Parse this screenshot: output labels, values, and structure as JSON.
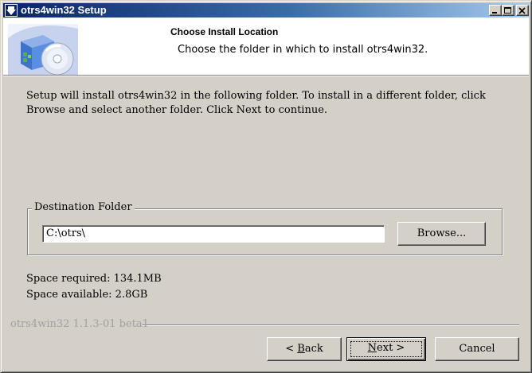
{
  "window": {
    "title": "otrs4win32 Setup"
  },
  "header": {
    "title": "Choose Install Location",
    "subtitle": "Choose the folder in which to install otrs4win32."
  },
  "body": {
    "intro": "Setup will install otrs4win32 in the following folder. To install in a different folder, click Browse and select another folder. Click Next to continue."
  },
  "destination": {
    "group_label": "Destination Folder",
    "path_value": "C:\\otrs\\",
    "browse_label": "Browse..."
  },
  "space": {
    "required": "Space required: 134.1MB",
    "available": "Space available: 2.8GB"
  },
  "footer": {
    "brand": "otrs4win32 1.1.3-01 beta1",
    "back_prefix": "< ",
    "back_key": "B",
    "back_rest": "ack",
    "next_key": "N",
    "next_rest": "ext >",
    "cancel_label": "Cancel"
  },
  "icons": {
    "title_icon": "installer-arrow-icon",
    "header_icon": "install-box-cd-icon"
  },
  "colors": {
    "title_active": "#0a246a",
    "title_gradient_end": "#a6caf0",
    "face": "#d4d0c8"
  }
}
